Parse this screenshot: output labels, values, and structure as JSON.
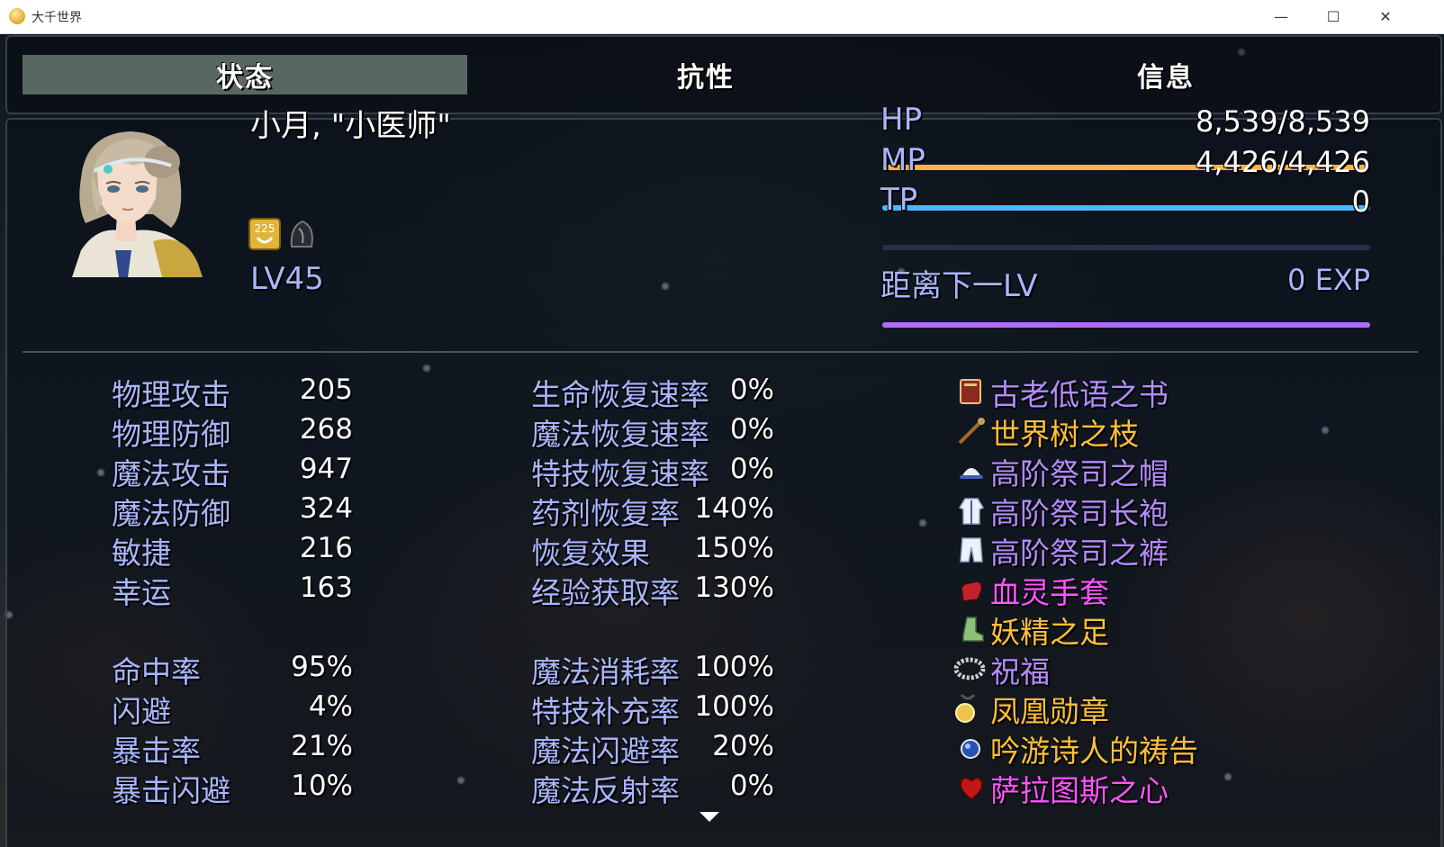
{
  "window": {
    "title": "大千世界",
    "buttons": {
      "minimize": "—",
      "maximize": "☐",
      "close": "✕"
    }
  },
  "tabs": [
    {
      "label": "状态",
      "active": true
    },
    {
      "label": "抗性",
      "active": false
    },
    {
      "label": "信息",
      "active": false
    }
  ],
  "actor": {
    "name": "小月, \"小医师\"",
    "level_text": "LV45",
    "state_badge_text": "225"
  },
  "gauges": {
    "hp": {
      "label": "HP",
      "value": "8,539/8,539",
      "fill": 1.0
    },
    "mp": {
      "label": "MP",
      "value": "4,426/4,426",
      "fill": 1.0
    },
    "tp": {
      "label": "TP",
      "value": "0",
      "fill": 0.0
    },
    "exp": {
      "label": "距离下一LV",
      "value": "0 EXP",
      "fill": 1.0
    }
  },
  "base_stats": [
    {
      "label": "物理攻击",
      "value": "205"
    },
    {
      "label": "物理防御",
      "value": "268"
    },
    {
      "label": "魔法攻击",
      "value": "947"
    },
    {
      "label": "魔法防御",
      "value": "324"
    },
    {
      "label": "敏捷",
      "value": "216"
    },
    {
      "label": "幸运",
      "value": "163"
    }
  ],
  "hit_stats": [
    {
      "label": "命中率",
      "value": "95%"
    },
    {
      "label": "闪避",
      "value": "4%"
    },
    {
      "label": "暴击率",
      "value": "21%"
    },
    {
      "label": "暴击闪避",
      "value": "10%"
    }
  ],
  "regen_stats": [
    {
      "label": "生命恢复速率",
      "value": "0%"
    },
    {
      "label": "魔法恢复速率",
      "value": "0%"
    },
    {
      "label": "特技恢复速率",
      "value": "0%"
    },
    {
      "label": "药剂恢复率",
      "value": "140%"
    },
    {
      "label": "恢复效果",
      "value": "150%"
    },
    {
      "label": "经验获取率",
      "value": "130%"
    }
  ],
  "rate_stats": [
    {
      "label": "魔法消耗率",
      "value": "100%"
    },
    {
      "label": "特技补充率",
      "value": "100%"
    },
    {
      "label": "魔法闪避率",
      "value": "20%"
    },
    {
      "label": "魔法反射率",
      "value": "0%"
    }
  ],
  "equipment": [
    {
      "name": "古老低语之书",
      "icon": "book-icon",
      "color": "#b58cff"
    },
    {
      "name": "世界树之枝",
      "icon": "staff-icon",
      "color": "#ffc03a"
    },
    {
      "name": "高阶祭司之帽",
      "icon": "hat-icon",
      "color": "#b58cff"
    },
    {
      "name": "高阶祭司长袍",
      "icon": "robe-icon",
      "color": "#b58cff"
    },
    {
      "name": "高阶祭司之裤",
      "icon": "pants-icon",
      "color": "#b58cff"
    },
    {
      "name": "血灵手套",
      "icon": "glove-icon",
      "color": "#ff55ff"
    },
    {
      "name": "妖精之足",
      "icon": "boots-icon",
      "color": "#ffc03a"
    },
    {
      "name": "祝福",
      "icon": "bracelet-icon",
      "color": "#b58cff"
    },
    {
      "name": "凤凰勋章",
      "icon": "medal-icon",
      "color": "#ffc03a"
    },
    {
      "name": "吟游诗人的祷告",
      "icon": "amulet-icon",
      "color": "#ffc03a"
    },
    {
      "name": "萨拉图斯之心",
      "icon": "heart-icon",
      "color": "#ff55ff"
    }
  ],
  "colors": {
    "system_label": "#a9b6ff",
    "hp_gauge": "#ffb347",
    "mp_gauge": "#49b8ff",
    "exp_gauge": "#b06cff"
  }
}
